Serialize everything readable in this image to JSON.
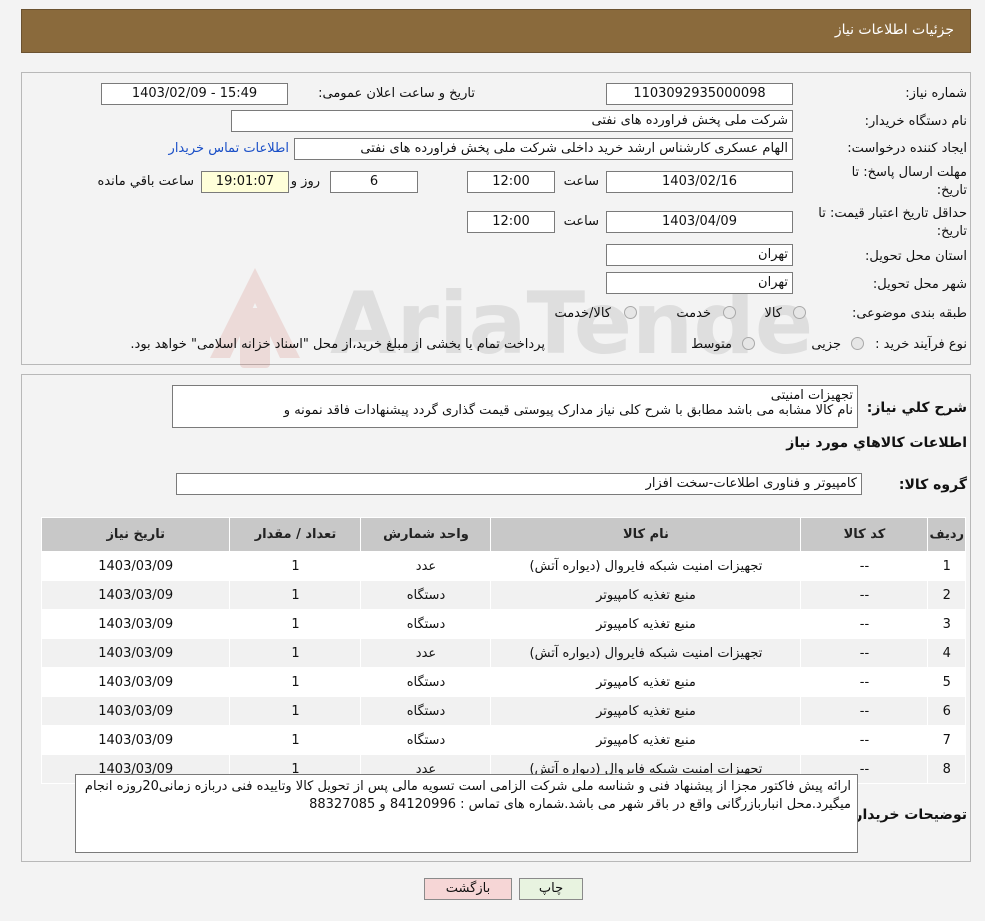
{
  "header": {
    "title": "جزئیات اطلاعات نیاز"
  },
  "form": {
    "need_number_label": "شماره نیاز:",
    "need_number": "1103092935000098",
    "announce_label": "تاریخ و ساعت اعلان عمومی:",
    "announce_value": "1403/02/09 - 15:49",
    "buyer_org_label": "نام دستگاه خریدار:",
    "buyer_org": "شرکت ملی پخش فراورده های نفتی",
    "creator_label": "ایجاد کننده درخواست:",
    "creator": "الهام عسکری کارشناس ارشد خرید داخلی شرکت ملی پخش فراورده های نفتی",
    "contact_link": "اطلاعات تماس خریدار",
    "deadline_label_1": "مهلت ارسال پاسخ: تا",
    "deadline_label_2": "تاریخ:",
    "deadline_date": "1403/02/16",
    "time_label": "ساعت",
    "deadline_time": "12:00",
    "days_value": "6",
    "days_label": "روز و",
    "remaining_value": "19:01:07",
    "remaining_label": "ساعت باقي مانده",
    "validity_label_1": "حداقل تاریخ اعتبار قیمت: تا",
    "validity_label_2": "تاریخ:",
    "validity_date": "1403/04/09",
    "validity_time": "12:00",
    "province_label": "استان محل تحویل:",
    "province": "تهران",
    "city_label": "شهر محل تحویل:",
    "city": "تهران",
    "category_label": "طبقه بندی موضوعی:",
    "category_options": [
      "کالا",
      "خدمت",
      "کالا/خدمت"
    ],
    "process_label": "نوع فرآیند خرید :",
    "process_options": [
      "جزیی",
      "متوسط"
    ],
    "process_note": "پرداخت تمام یا بخشی از مبلغ خرید،از محل \"اسناد خزانه اسلامی\" خواهد بود."
  },
  "summary": {
    "label": "شرح کلي نياز:",
    "line1": "تجهیزات امنیتی",
    "line2": "نام کالا مشابه می باشد مطابق با شرح کلی نیاز مدارک پیوستی قیمت گذاری گردد پیشنهادات فاقد نمونه و"
  },
  "goods_section_title": "اطلاعات کالاهاي مورد نياز",
  "goods_group": {
    "label": "گروه کالا:",
    "value": "کامپیوتر و فناوری اطلاعات-سخت افزار"
  },
  "table": {
    "headers": [
      "رديف",
      "کد کالا",
      "نام کالا",
      "واحد شمارش",
      "تعداد / مقدار",
      "تاریخ نیاز"
    ],
    "rows": [
      [
        "1",
        "--",
        "تجهیزات امنیت شبکه فایروال (دیواره آتش)",
        "عدد",
        "1",
        "1403/03/09"
      ],
      [
        "2",
        "--",
        "منبع تغذیه کامپیوتر",
        "دستگاه",
        "1",
        "1403/03/09"
      ],
      [
        "3",
        "--",
        "منبع تغذیه کامپیوتر",
        "دستگاه",
        "1",
        "1403/03/09"
      ],
      [
        "4",
        "--",
        "تجهیزات امنیت شبکه فایروال (دیواره آتش)",
        "عدد",
        "1",
        "1403/03/09"
      ],
      [
        "5",
        "--",
        "منبع تغذیه کامپیوتر",
        "دستگاه",
        "1",
        "1403/03/09"
      ],
      [
        "6",
        "--",
        "منبع تغذیه کامپیوتر",
        "دستگاه",
        "1",
        "1403/03/09"
      ],
      [
        "7",
        "--",
        "منبع تغذیه کامپیوتر",
        "دستگاه",
        "1",
        "1403/03/09"
      ],
      [
        "8",
        "--",
        "تجهیزات امنیت شبکه فایروال (دیواره آتش)",
        "عدد",
        "1",
        "1403/03/09"
      ]
    ]
  },
  "buyer_notes": {
    "label": "توضیحات خریدار:",
    "text": "ارائه پیش فاکتور مجزا از پیشنهاد فنی و شناسه ملی شرکت الزامی است تسویه مالی پس از تحویل کالا وتاییده فنی دربازه زمانی20روزه انجام میگیرد.محل انباربازرگانی واقع در باقر شهر می باشد.شماره های تماس : 84120996 و 88327085"
  },
  "buttons": {
    "print": "چاپ",
    "back": "بازگشت"
  },
  "watermark": "AriaTender.neT",
  "colors": {
    "header_bg": "#8a6a3c",
    "link": "#1a4fc7",
    "back_button": "#f6d6d6",
    "print_button": "#e8f3e0"
  }
}
